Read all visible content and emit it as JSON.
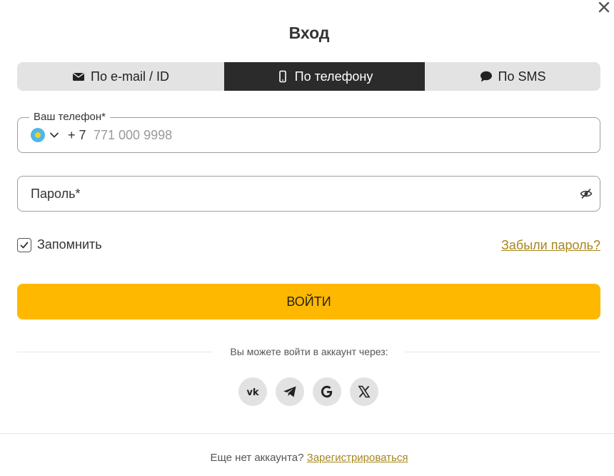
{
  "dialog": {
    "title": "Вход"
  },
  "tabs": [
    {
      "label": "По e-mail / ID",
      "icon": "envelope-icon",
      "active": false
    },
    {
      "label": "По телефону",
      "icon": "phone-icon",
      "active": true
    },
    {
      "label": "По SMS",
      "icon": "chat-icon",
      "active": false
    }
  ],
  "phone_field": {
    "legend": "Ваш телефон*",
    "country_flag": "kazakhstan-flag-icon",
    "code": "+ 7",
    "placeholder": "771 000 9998"
  },
  "password_field": {
    "placeholder": "Пароль*",
    "toggle_icon": "eye-off-icon"
  },
  "remember": {
    "label": "Запомнить",
    "checked": true
  },
  "forgot_link": "Забыли пароль?",
  "login_button": "ВОЙТИ",
  "social_divider": "Вы можете войти в аккаунт через:",
  "socials": [
    "vk-icon",
    "telegram-icon",
    "google-icon",
    "x-icon"
  ],
  "footer": {
    "text": "Еще нет аккаунта?",
    "link": "Зарегистрироваться"
  },
  "colors": {
    "accent": "#ffb800",
    "active_tab": "#2b2b2b",
    "link": "#a8861e"
  }
}
